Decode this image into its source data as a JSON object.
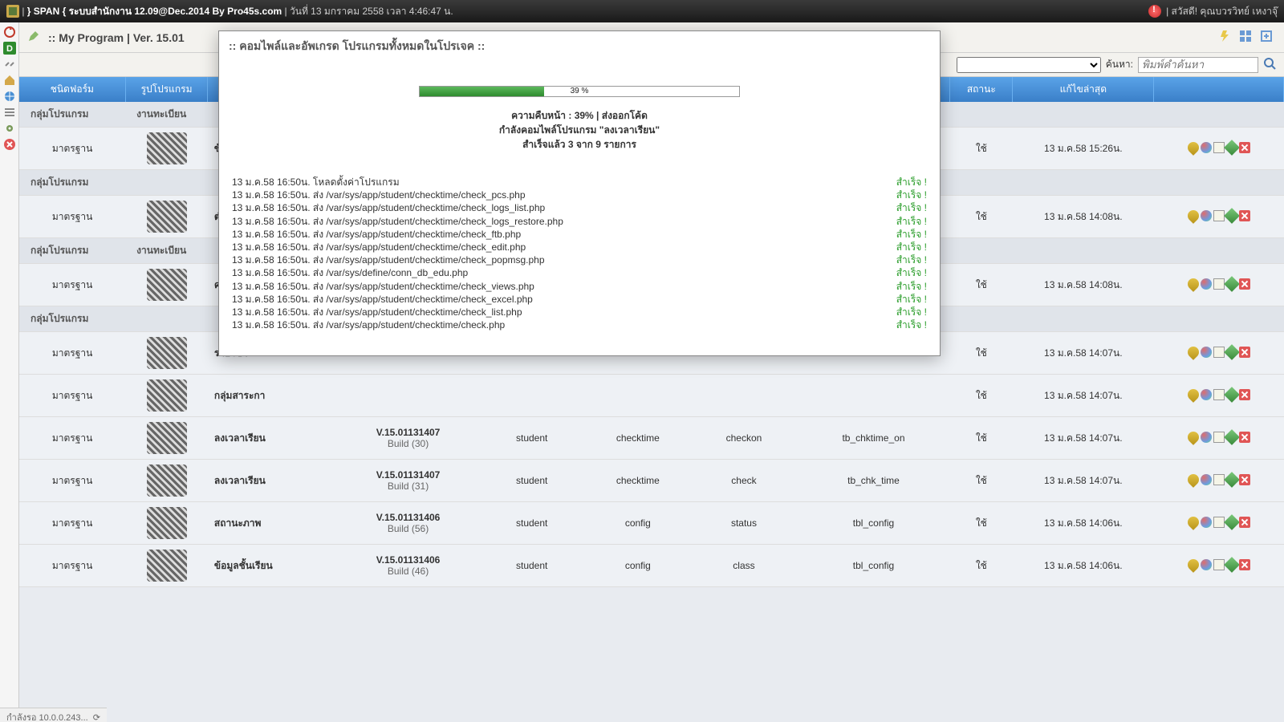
{
  "topbar": {
    "left_icon": "app-icon",
    "brand": "} SPAN { ระบบสำนักงาน 12.09@Dec.2014 By Pro45s.com",
    "datetime": "วันที่ 13 มกราคม 2558 เวลา 4:46:47 น.",
    "welcome": "| สวัสดี! คุณบวรวิทย์ เหงาจุ๊"
  },
  "toolbar": {
    "title": ":: My Program  |  Ver. 15.01"
  },
  "filter": {
    "search_label": "ค้นหา:",
    "search_placeholder": "พิมพ์คำค้นหา"
  },
  "columns": {
    "c1": "ชนิดฟอร์ม",
    "c2": "รูปโปรแกรม",
    "c9": "สถานะ",
    "c10": "แก้ไขล่าสุด"
  },
  "groups": [
    {
      "label": "กลุ่มโปรแกรม",
      "sub": "งานทะเบียน"
    },
    {
      "label": "กลุ่มโปรแกรม",
      "sub": ""
    },
    {
      "label": "กลุ่มโปรแกรม",
      "sub": "งานทะเบียน"
    },
    {
      "label": "กลุ่มโปรแกรม",
      "sub": ""
    }
  ],
  "rows": [
    {
      "type": "มาตรฐาน",
      "name": "ข้อมูลนักเรียน",
      "version": "",
      "build": "",
      "mod1": "",
      "mod2": "",
      "mod3": "",
      "tbl": "",
      "status": "ใช้",
      "updated": "13 ม.ค.58 15:26น.",
      "group_after": 0
    },
    {
      "type": "มาตรฐาน",
      "name": "ตำแหน่ง",
      "version": "",
      "build": "",
      "mod1": "",
      "mod2": "",
      "mod3": "",
      "tbl": "",
      "status": "ใช้",
      "updated": "13 ม.ค.58 14:08น.",
      "group_after": 1
    },
    {
      "type": "มาตรฐาน",
      "name": "ครูผู้สอน",
      "version": "",
      "build": "",
      "mod1": "",
      "mod2": "",
      "mod3": "",
      "tbl": "",
      "status": "ใช้",
      "updated": "13 ม.ค.58 14:08น.",
      "group_after": 2
    },
    {
      "type": "มาตรฐาน",
      "name": "รายวิชา",
      "version": "",
      "build": "",
      "mod1": "",
      "mod2": "",
      "mod3": "",
      "tbl": "",
      "status": "ใช้",
      "updated": "13 ม.ค.58 14:07น.",
      "group_after": 3
    },
    {
      "type": "มาตรฐาน",
      "name": "กลุ่มสาระกา",
      "version": "",
      "build": "",
      "mod1": "",
      "mod2": "",
      "mod3": "",
      "tbl": "",
      "status": "ใช้",
      "updated": "13 ม.ค.58 14:07น."
    },
    {
      "type": "มาตรฐาน",
      "name": "ลงเวลาเรียน",
      "version": "V.15.01131407",
      "build": "Build (30)",
      "mod1": "student",
      "mod2": "checktime",
      "mod3": "checkon",
      "tbl": "tb_chktime_on",
      "status": "ใช้",
      "updated": "13 ม.ค.58 14:07น."
    },
    {
      "type": "มาตรฐาน",
      "name": "ลงเวลาเรียน",
      "version": "V.15.01131407",
      "build": "Build (31)",
      "mod1": "student",
      "mod2": "checktime",
      "mod3": "check",
      "tbl": "tb_chk_time",
      "status": "ใช้",
      "updated": "13 ม.ค.58 14:07น."
    },
    {
      "type": "มาตรฐาน",
      "name": "สถานะภาพ",
      "version": "V.15.01131406",
      "build": "Build (56)",
      "mod1": "student",
      "mod2": "config",
      "mod3": "status",
      "tbl": "tbl_config",
      "status": "ใช้",
      "updated": "13 ม.ค.58 14:06น."
    },
    {
      "type": "มาตรฐาน",
      "name": "ข้อมูลชั้นเรียน",
      "version": "V.15.01131406",
      "build": "Build (46)",
      "mod1": "student",
      "mod2": "config",
      "mod3": "class",
      "tbl": "tbl_config",
      "status": "ใช้",
      "updated": "13 ม.ค.58 14:06น."
    }
  ],
  "modal": {
    "title": ":: คอมไพล์และอัพเกรด โปรแกรมทั้งหมดในโปรเจค ::",
    "progress_pct": 39,
    "progress_label": "39 %",
    "line1": "ความคืบหน้า : 39%  |  ส่งออกโค้ด",
    "line2": "กำลังคอมไพล์โปรแกรม \"ลงเวลาเรียน\"",
    "line3": "สำเร็จแล้ว 3 จาก 9 รายการ",
    "ok_label": "สำเร็จ !",
    "logs": [
      "13 ม.ค.58 16:50น. โหลดตั้งค่าโปรแกรม",
      "13 ม.ค.58 16:50น. ส่ง /var/sys/app/student/checktime/check_pcs.php",
      "13 ม.ค.58 16:50น. ส่ง /var/sys/app/student/checktime/check_logs_list.php",
      "13 ม.ค.58 16:50น. ส่ง /var/sys/app/student/checktime/check_logs_restore.php",
      "13 ม.ค.58 16:50น. ส่ง /var/sys/app/student/checktime/check_ftb.php",
      "13 ม.ค.58 16:50น. ส่ง /var/sys/app/student/checktime/check_edit.php",
      "13 ม.ค.58 16:50น. ส่ง /var/sys/app/student/checktime/check_popmsg.php",
      "13 ม.ค.58 16:50น. ส่ง /var/sys/define/conn_db_edu.php",
      "13 ม.ค.58 16:50น. ส่ง /var/sys/app/student/checktime/check_views.php",
      "13 ม.ค.58 16:50น. ส่ง /var/sys/app/student/checktime/check_excel.php",
      "13 ม.ค.58 16:50น. ส่ง /var/sys/app/student/checktime/check_list.php",
      "13 ม.ค.58 16:50น. ส่ง /var/sys/app/student/checktime/check.php"
    ]
  },
  "statusbar": {
    "text": "กำลังรอ 10.0.0.243..."
  }
}
